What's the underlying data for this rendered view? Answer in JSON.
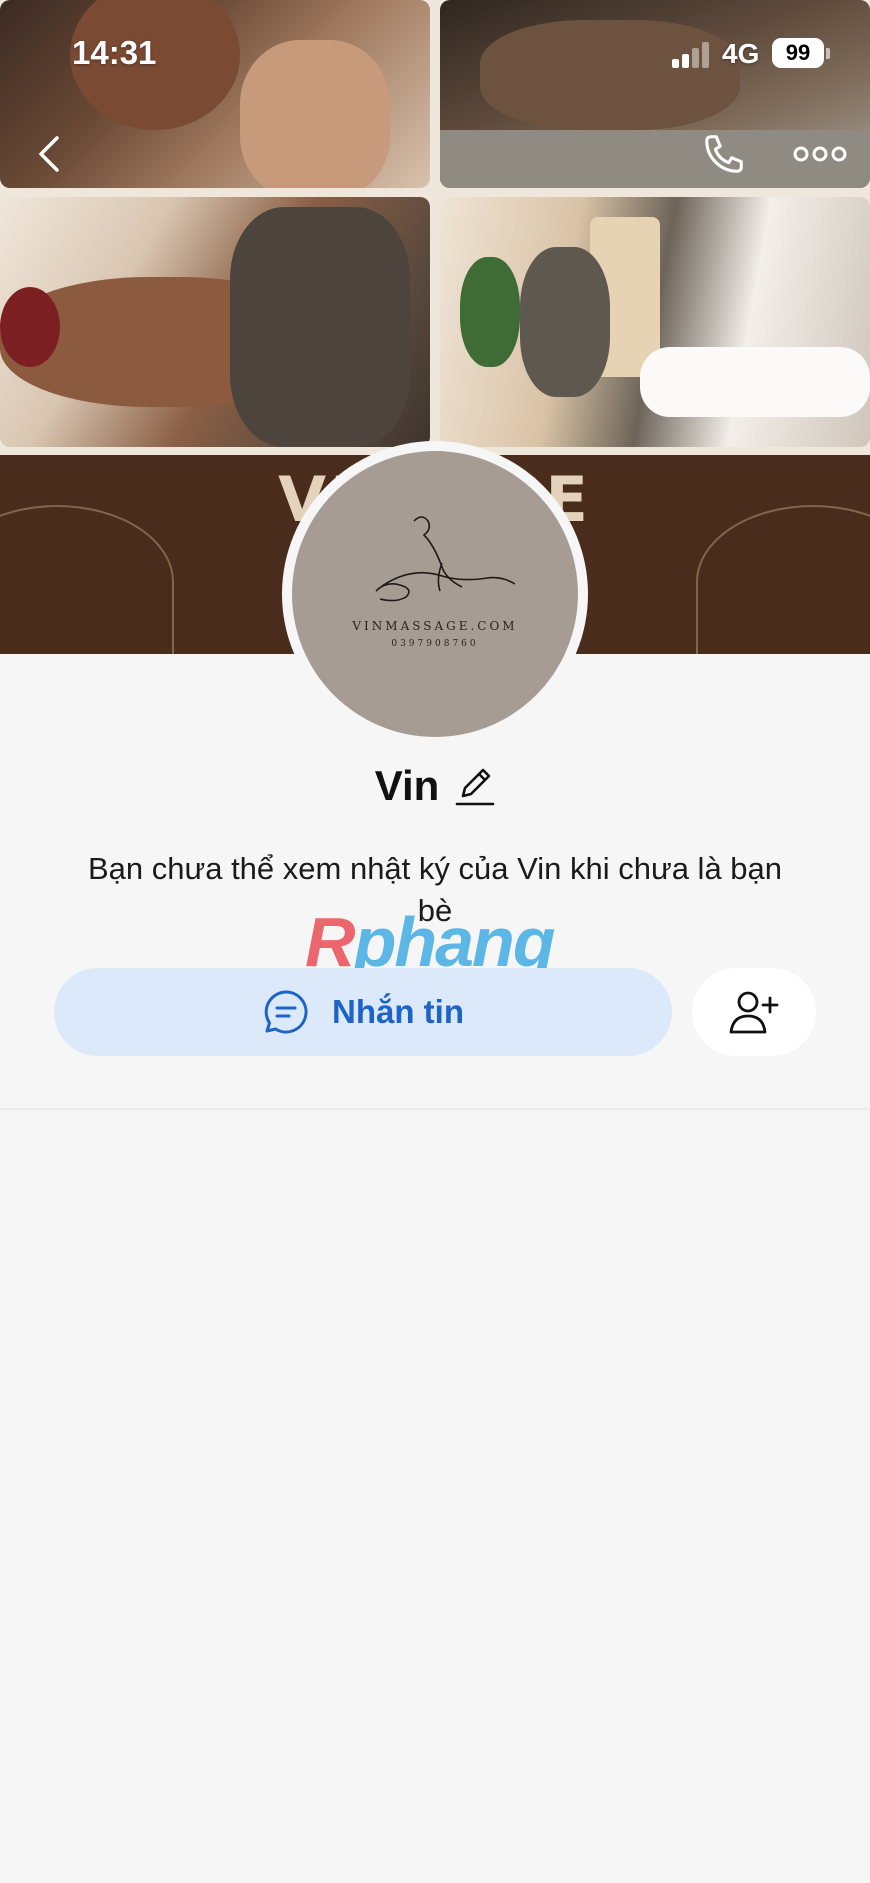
{
  "status_bar": {
    "time": "14:31",
    "network": "4G",
    "battery": "99"
  },
  "cover": {
    "banner_text": "VIN        AGE"
  },
  "avatar": {
    "site": "VINMASSAGE.COM",
    "phone": "0397908760"
  },
  "profile": {
    "name": "Vin",
    "notice": "Bạn chưa thể xem nhật ký của Vin khi chưa là bạn bè"
  },
  "watermark": {
    "part1": "R",
    "part2": "phang"
  },
  "actions": {
    "message_label": "Nhắn tin"
  },
  "colors": {
    "accent": "#1e64c8",
    "message_button_bg": "#dbe9fb",
    "background": "#f6f6f7"
  },
  "icons": {
    "back": "chevron-left-icon",
    "call": "phone-icon",
    "more": "more-horizontal-icon",
    "edit": "pencil-icon",
    "message": "chat-bubble-icon",
    "add_friend": "add-user-icon"
  }
}
